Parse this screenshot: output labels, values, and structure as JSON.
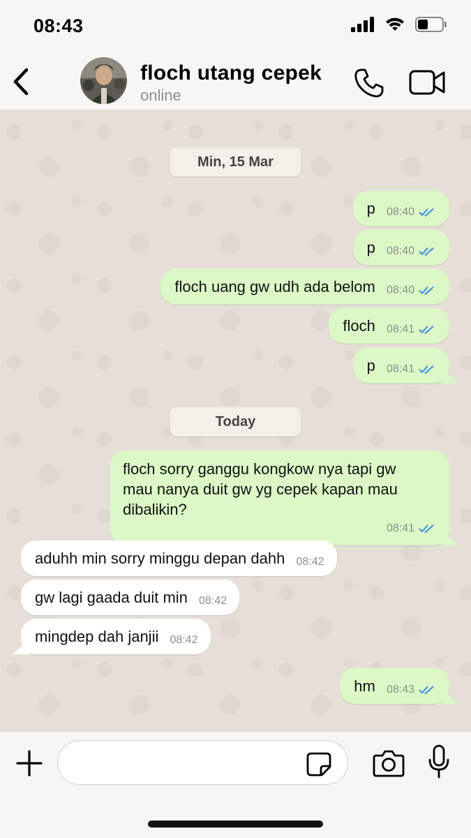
{
  "status_bar": {
    "time": "08:43"
  },
  "header": {
    "contact_name": "floch utang cepek",
    "contact_status": "online"
  },
  "chat": {
    "date_chips": [
      "Min, 15 Mar",
      "Today"
    ],
    "messages": [
      {
        "direction": "out",
        "text": "p",
        "time": "08:40",
        "read": true
      },
      {
        "direction": "out",
        "text": "p",
        "time": "08:40",
        "read": true
      },
      {
        "direction": "out",
        "text": "floch uang gw udh ada belom",
        "time": "08:40",
        "read": true
      },
      {
        "direction": "out",
        "text": "floch",
        "time": "08:41",
        "read": true
      },
      {
        "direction": "out",
        "text": "p",
        "time": "08:41",
        "read": true
      },
      {
        "direction": "out",
        "lines": [
          "floch sorry ganggu kongkow nya tapi gw",
          "mau nanya duit gw yg cepek kapan mau",
          "dibalikin?"
        ],
        "time": "08:41",
        "read": true
      },
      {
        "direction": "in",
        "text": "aduhh min sorry minggu depan dahh",
        "time": "08:42"
      },
      {
        "direction": "in",
        "text": "gw lagi gaada duit min",
        "time": "08:42"
      },
      {
        "direction": "in",
        "text": "mingdep dah janjii",
        "time": "08:42"
      },
      {
        "direction": "out",
        "text": "hm",
        "time": "08:43",
        "read": true
      }
    ]
  },
  "input": {
    "placeholder": ""
  },
  "colors": {
    "outgoing_bubble": "#dcf8c6",
    "incoming_bubble": "#ffffff",
    "read_ticks": "#3d8fe0",
    "chat_bg": "#e6dfd7"
  },
  "icons": [
    "back-chevron-icon",
    "phone-icon",
    "video-camera-icon",
    "plus-icon",
    "sticker-icon",
    "camera-icon",
    "microphone-icon",
    "double-check-icon",
    "signal-icon",
    "wifi-icon",
    "battery-icon"
  ]
}
